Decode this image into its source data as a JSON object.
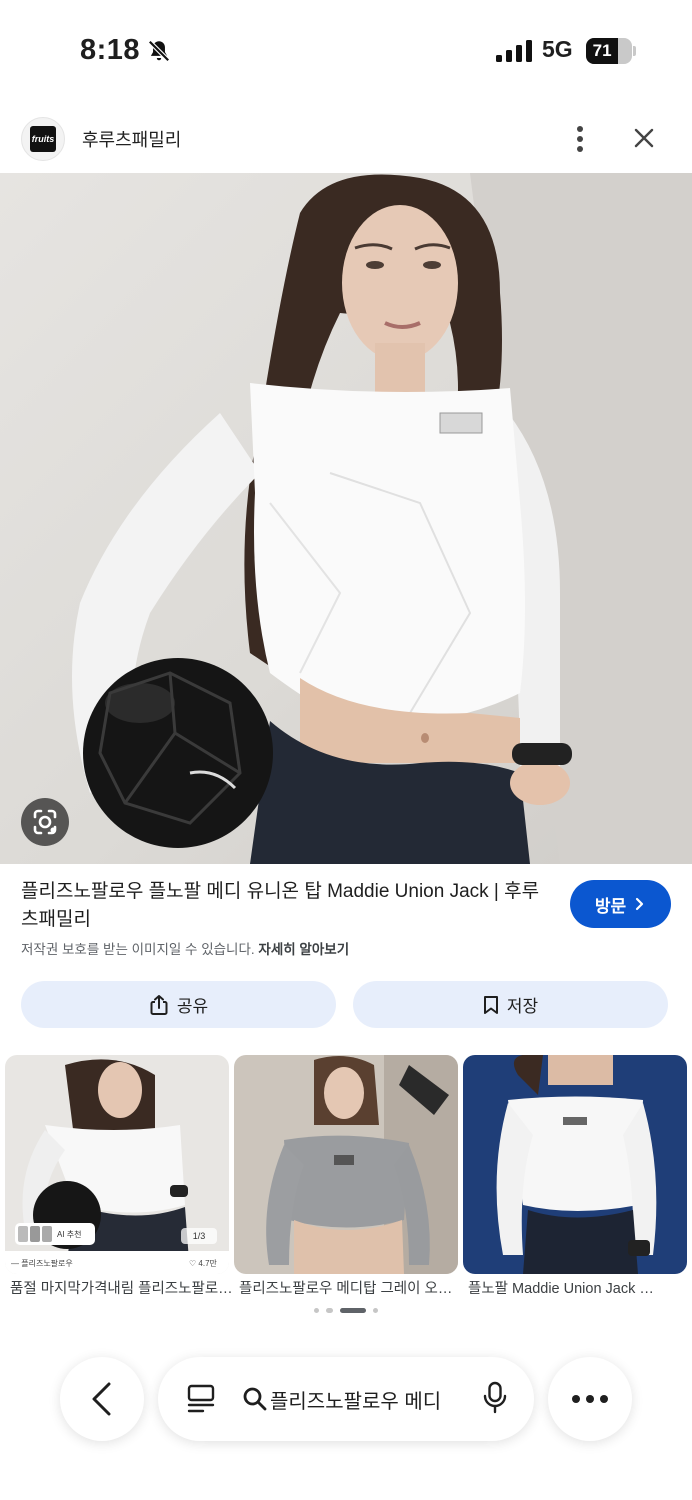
{
  "status": {
    "time": "8:18",
    "network": "5G",
    "battery": "71"
  },
  "header": {
    "site_name": "후루츠패밀리",
    "logo_text": "fruits"
  },
  "result": {
    "title": "플리즈노팔로우 플노팔 메디 유니온 탑 Maddie Union Jack | 후루츠패밀리",
    "visit_label": "방문",
    "copyright_text": "저작권 보호를 받는 이미지일 수 있습니다.",
    "learn_more": "자세히 알아보기",
    "share_label": "공유",
    "save_label": "저장"
  },
  "related": [
    {
      "caption": "품절 마지막가격내림 플리즈노팔로우 플노팔 메디 유니온 탑",
      "seller": "플리즈노팔로우",
      "likes": "4.7만",
      "counter": "1/3",
      "ai_tag": "AI 추천"
    },
    {
      "caption": "플리즈노팔로우 메디탑 그레이 오프숄더"
    },
    {
      "caption": "플노팔 Maddie Union Jack 화이트"
    }
  ],
  "carousel": {
    "count": 4,
    "active": 2
  },
  "bottom": {
    "query": "플리즈노팔로우 메디"
  },
  "colors": {
    "accent": "#0b57d0",
    "pill_bg": "#e7eefb",
    "text": "#1f1f1f",
    "muted": "#5f6368"
  },
  "icons": [
    "bell-off-icon",
    "signal-icon",
    "more-vert-icon",
    "close-icon",
    "lens-icon",
    "chevron-right-icon",
    "share-icon",
    "bookmark-icon",
    "back-icon",
    "tabs-icon",
    "search-icon",
    "mic-icon",
    "more-horiz-icon"
  ]
}
